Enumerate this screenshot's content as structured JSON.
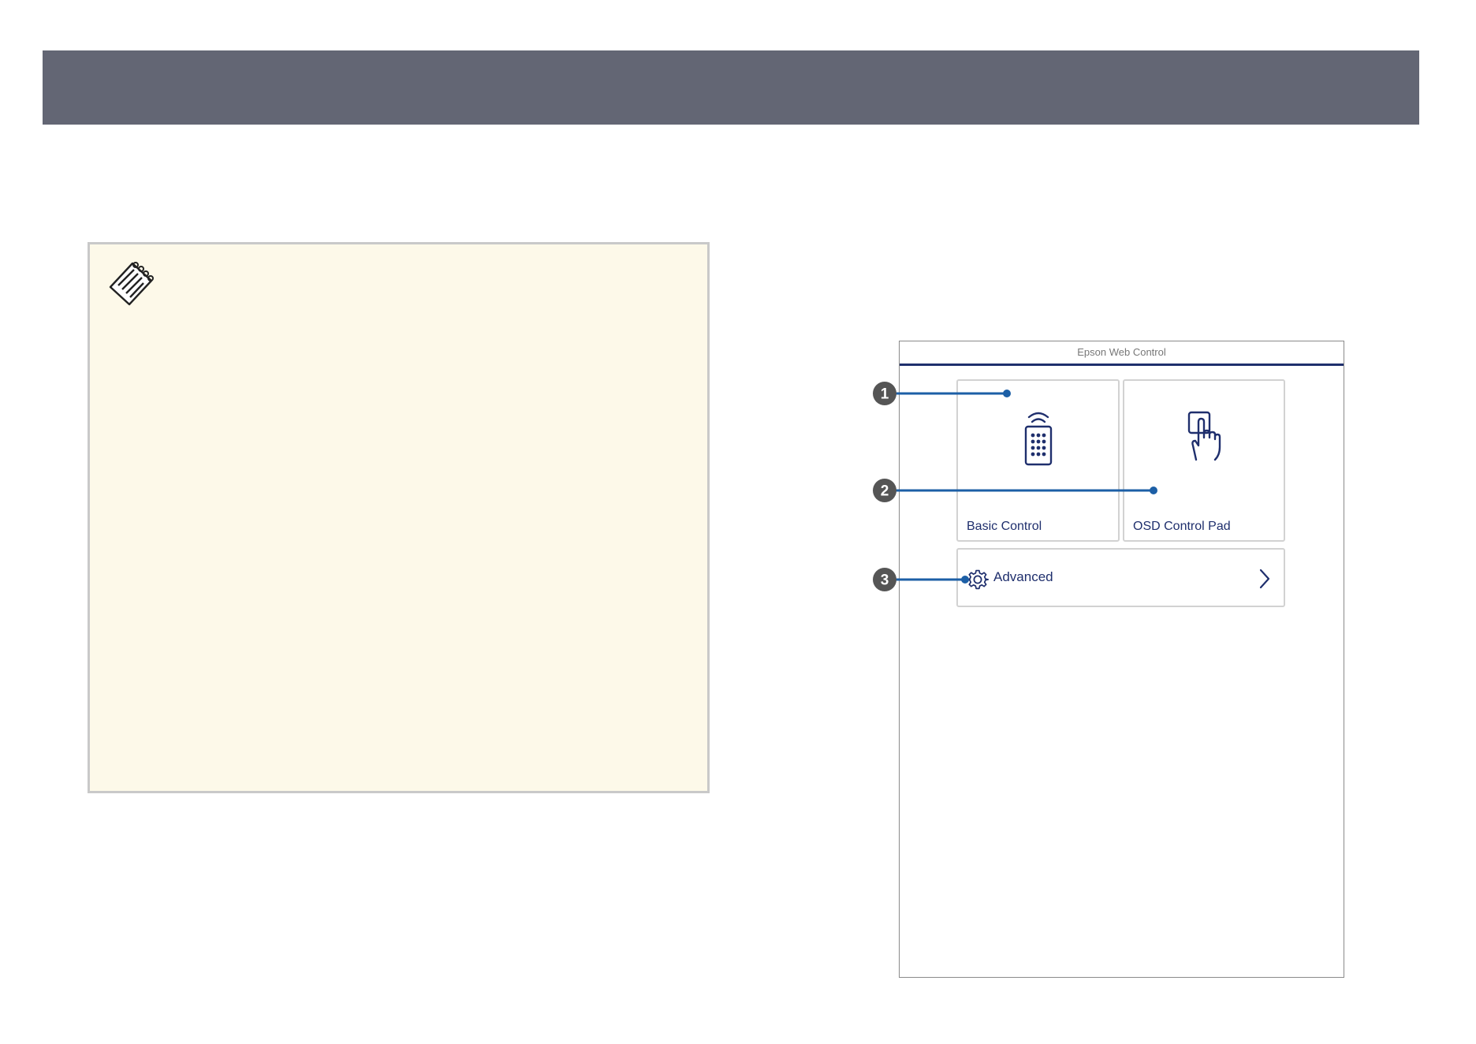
{
  "screen": {
    "title": "Epson Web Control",
    "tiles": {
      "basic_label": "Basic Control",
      "osd_label": "OSD Control Pad",
      "advanced_label": "Advanced"
    }
  },
  "callouts": [
    "1",
    "2",
    "3"
  ],
  "colors": {
    "header_band": "#636674",
    "note_background": "#fdf9e9",
    "accent_navy": "#1f2f6d",
    "callout_blue": "#1c5fa6",
    "callout_badge": "#555555"
  },
  "icons": {
    "note": "note-pad-icon",
    "basic": "remote-control-icon",
    "osd": "touch-pad-hand-icon",
    "advanced": "gear-icon",
    "chevron": "chevron-right-icon"
  }
}
